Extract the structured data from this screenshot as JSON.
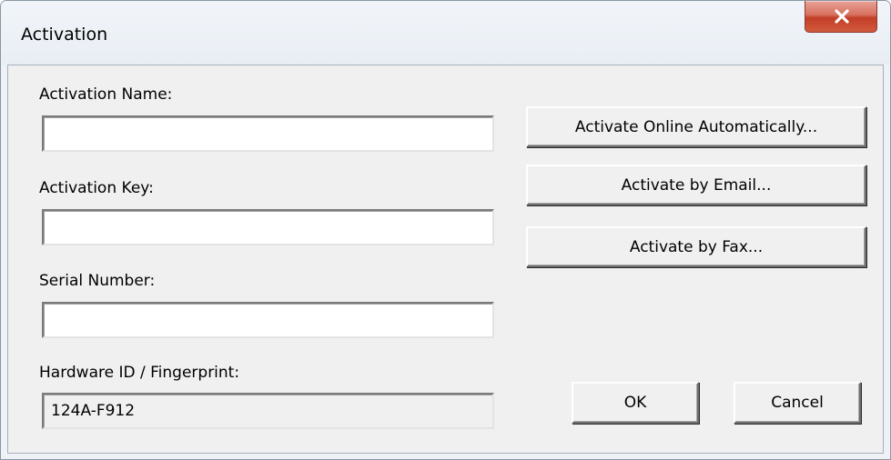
{
  "window": {
    "title": "Activation",
    "close_glyph": "x"
  },
  "form": {
    "activation_name_label": "Activation Name:",
    "activation_name_value": "",
    "activation_key_label": "Activation Key:",
    "activation_key_value": "",
    "serial_number_label": "Serial Number:",
    "serial_number_value": "",
    "hardware_id_label": "Hardware ID / Fingerprint:",
    "hardware_id_value": "124A-F912"
  },
  "actions": {
    "online_label": "Activate Online Automatically...",
    "email_label": "Activate by Email...",
    "fax_label": "Activate by Fax...",
    "ok_label": "OK",
    "cancel_label": "Cancel"
  },
  "colors": {
    "window_bg": "#eef2f6",
    "client_bg": "#f0f0f0",
    "close_button": "#c7432b"
  },
  "icons": {
    "close": "close-icon"
  }
}
